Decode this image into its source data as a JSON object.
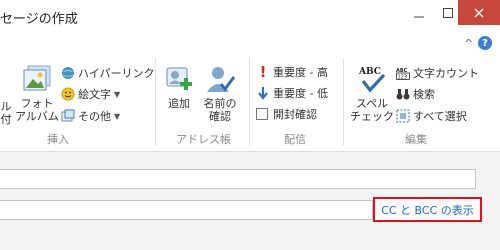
{
  "window": {
    "title": "セージの作成",
    "minimize_icon": "minimize-icon",
    "maximize_icon": "maximize-icon",
    "close_icon": "close-icon"
  },
  "ribbon": {
    "help_icon": "help-icon",
    "collapse_icon": "chevron-up-icon",
    "help_glyph": "?",
    "collapse_glyph": "^",
    "groups": {
      "insert": {
        "label": "挿入",
        "partial_button": [
          "ル",
          "付"
        ],
        "photo_album": [
          "フォト",
          "アルバム"
        ],
        "hyperlink": "ハイパーリンク",
        "emoji": "絵文字",
        "other": "その他"
      },
      "address_book": {
        "label": "アドレス帳",
        "add": "追加",
        "check_names": [
          "名前の",
          "確認"
        ]
      },
      "flags": {
        "label": "配信",
        "priority_high": "重要度 - 高",
        "priority_low": "重要度 - 低",
        "read_receipt": "開封確認"
      },
      "editing": {
        "label": "編集",
        "spelling": [
          "スペル",
          "チェック"
        ],
        "word_count": "文字カウント",
        "find": "検索",
        "select_all": "すべて選択"
      }
    }
  },
  "compose": {
    "cc_bcc_link": "CC と BCC の表示"
  },
  "colors": {
    "accent_blue": "#1e6ebf",
    "close_red": "#c7473c",
    "highlight_red": "#e0101c"
  }
}
